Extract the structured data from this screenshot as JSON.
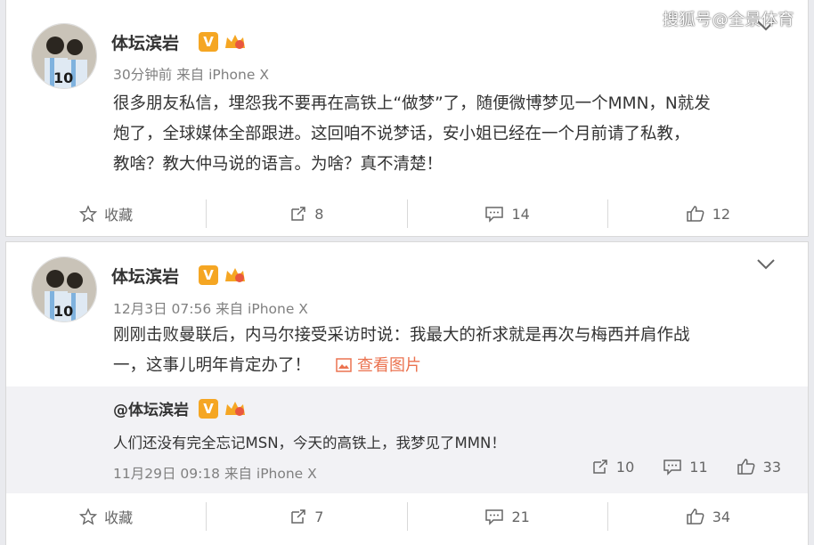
{
  "watermark": "搜狐号@全景体育",
  "posts": [
    {
      "author": "体坛滨岩",
      "meta": "30分钟前 来自 iPhone X",
      "lines": [
        "很多朋友私信，埋怨我不要再在高铁上“做梦”了，随便微博梦见一个MMN，N就发",
        "炮了，全球媒体全部跟进。这回咱不说梦话，安小姐已经在一个月前请了私教，",
        "教啥？教大仲马说的语言。为啥？真不清楚！"
      ],
      "actions": {
        "favorite": "收藏",
        "repost": "8",
        "comment": "14",
        "like": "12"
      }
    },
    {
      "author": "体坛滨岩",
      "meta": "12月3日 07:56 来自 iPhone X",
      "lines": [
        "刚刚击败曼联后，内马尔接受采访时说：我最大的祈求就是再次与梅西并肩作战",
        "一，这事儿明年肯定办了！"
      ],
      "see_pic": "查看图片",
      "repost": {
        "author": "@体坛滨岩",
        "text": "人们还没有完全忘记MSN，今天的高铁上，我梦见了MMN！",
        "meta": "11月29日 09:18 来自 iPhone X",
        "repost_count": "10",
        "comment_count": "11",
        "like_count": "33"
      },
      "actions": {
        "favorite": "收藏",
        "repost": "7",
        "comment": "21",
        "like": "34"
      }
    }
  ],
  "colors": {
    "link": "#eb7350",
    "badge": "#f5a623",
    "meta": "#808080"
  }
}
